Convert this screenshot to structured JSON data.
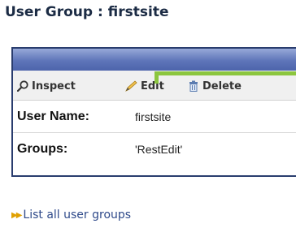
{
  "page": {
    "title": "User Group : firstsite"
  },
  "toolbar": {
    "inspect_label": "Inspect",
    "edit_label": "Edit",
    "delete_label": "Delete"
  },
  "details": {
    "rows": [
      {
        "label": "User Name:",
        "value": "firstsite"
      },
      {
        "label": "Groups:",
        "value": "'RestEdit'"
      }
    ]
  },
  "footer": {
    "list_link_label": "List all user groups"
  },
  "colors": {
    "header_gradient_top": "#97a9d8",
    "header_gradient_bottom": "#4d64ab",
    "panel_border": "#2a3d6e",
    "callout_arrow": "#8cc63f",
    "link": "#2f4a8a"
  },
  "icons": {
    "inspect": "magnifier-icon",
    "edit": "pencil-icon",
    "delete": "trash-icon",
    "list_link": "double-arrow-icon"
  }
}
